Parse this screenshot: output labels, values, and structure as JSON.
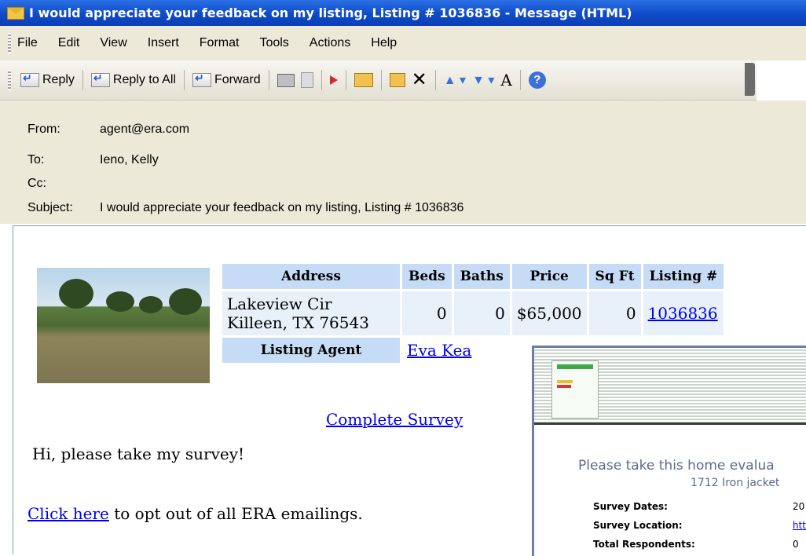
{
  "window": {
    "title": "I would appreciate your feedback on my listing, Listing # 1036836 - Message (HTML)"
  },
  "menu": [
    "File",
    "Edit",
    "View",
    "Insert",
    "Format",
    "Tools",
    "Actions",
    "Help"
  ],
  "toolbar": {
    "reply": "Reply",
    "reply_all": "Reply to All",
    "forward": "Forward",
    "font_size_glyph": "A"
  },
  "header": {
    "from_label": "From:",
    "from": "agent@era.com",
    "to_label": "To:",
    "to": "Ieno, Kelly",
    "cc_label": "Cc:",
    "cc": "",
    "subject_label": "Subject:",
    "subject": "I would appreciate your feedback on my listing, Listing # 1036836"
  },
  "listing": {
    "headers": [
      "Address",
      "Beds",
      "Baths",
      "Price",
      "Sq Ft",
      "Listing #"
    ],
    "address_line1": "Lakeview Cir",
    "address_line2": "Killeen, TX 76543",
    "beds": "0",
    "baths": "0",
    "price": "$65,000",
    "sqft": "0",
    "listing_number": "1036836",
    "agent_label": "Listing Agent",
    "agent_name": "Eva Kea"
  },
  "body": {
    "survey_link": "Complete Survey",
    "greeting": "Hi, please take my survey!",
    "optout_link": "Click here",
    "optout_rest": " to opt out of all ERA emailings."
  },
  "overlay": {
    "prompt": "Please take this home evalua",
    "address": "1712 Iron jacket",
    "rows": [
      {
        "label": "Survey Dates:",
        "value": "20"
      },
      {
        "label": "Survey Location:",
        "value": "htt"
      },
      {
        "label": "Total Respondents:",
        "value": "0"
      }
    ]
  },
  "colors": {
    "title_bar": "#0f4ac8",
    "chrome": "#ece9d8",
    "table_header": "#c6dcf6",
    "table_cell": "#e8f0fa",
    "link": "#0000ee"
  }
}
